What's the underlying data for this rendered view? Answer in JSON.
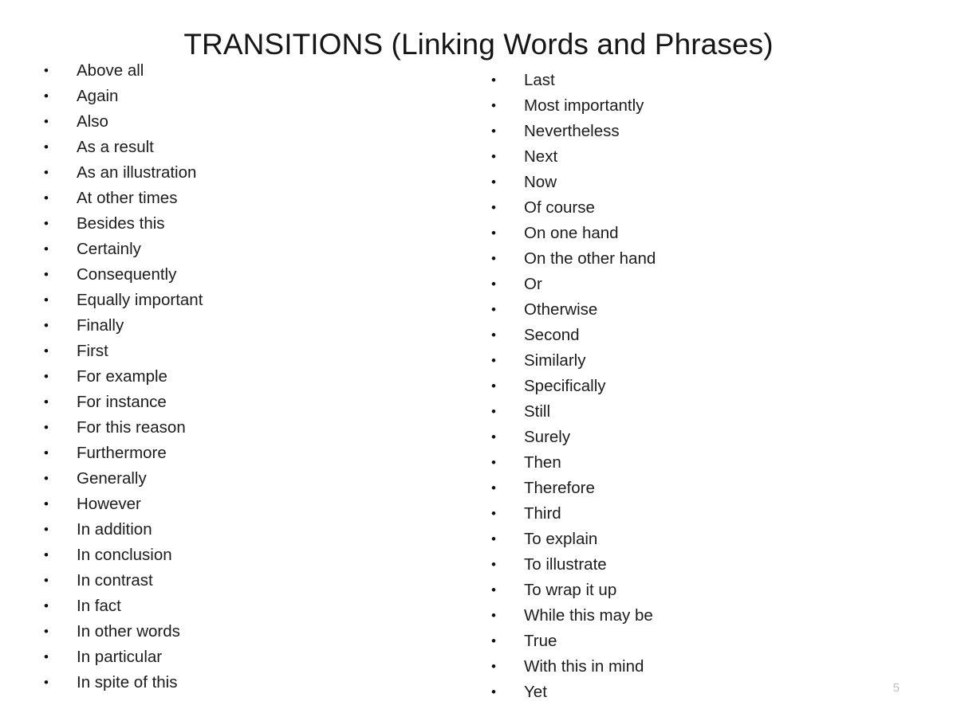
{
  "slide": {
    "title": "TRANSITIONS (Linking Words and Phrases)",
    "page_number": "5",
    "bullet_glyph": "•",
    "background_color": "#ffffff",
    "text_color": "#1c1c1c",
    "page_number_color": "#bfbfbf"
  },
  "columns": [
    {
      "name": "left-column",
      "items": [
        "Above all",
        "Again",
        "Also",
        "As a result",
        "As an illustration",
        "At other times",
        "Besides this",
        "Certainly",
        "Consequently",
        "Equally important",
        "Finally",
        "First",
        "For example",
        "For instance",
        "For this reason",
        "Furthermore",
        "Generally",
        "However",
        "In addition",
        "In conclusion",
        "In contrast",
        "In fact",
        "In other words",
        "In particular",
        "In spite of this"
      ]
    },
    {
      "name": "right-column",
      "items": [
        "Last",
        "Most importantly",
        "Nevertheless",
        "Next",
        "Now",
        "Of course",
        "On one hand",
        "On the other hand",
        "Or",
        "Otherwise",
        "Second",
        "Similarly",
        "Specifically",
        "Still",
        "Surely",
        "Then",
        "Therefore",
        "Third",
        "To explain",
        "To illustrate",
        "To wrap it up",
        "While this may be",
        "True",
        "With this in mind",
        "Yet"
      ]
    }
  ]
}
